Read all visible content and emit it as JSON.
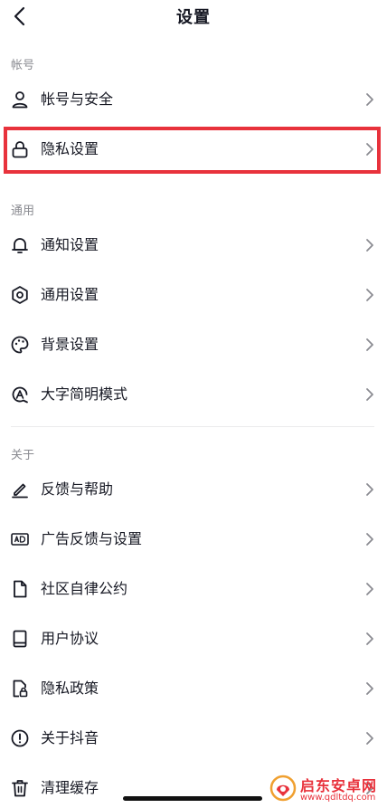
{
  "header": {
    "title": "设置"
  },
  "sections": {
    "account": "帐号",
    "general": "通用",
    "about": "关于"
  },
  "rows": [
    {
      "label": "帐号与安全"
    },
    {
      "label": "隐私设置"
    },
    {
      "label": "通知设置"
    },
    {
      "label": "通用设置"
    },
    {
      "label": "背景设置"
    },
    {
      "label": "大字简明模式"
    },
    {
      "label": "反馈与帮助"
    },
    {
      "label": "广告反馈与设置"
    },
    {
      "label": "社区自律公约"
    },
    {
      "label": "用户协议"
    },
    {
      "label": "隐私政策"
    },
    {
      "label": "关于抖音"
    },
    {
      "label": "清理缓存"
    }
  ],
  "icons": {
    "back": "chevron-left-icon",
    "row_chevron": "chevron-right-icon"
  },
  "colors": {
    "highlight": "#e8323c",
    "text": "#161823",
    "section_label": "#8a8b91",
    "chevron": "#8a8b91"
  },
  "watermark": {
    "title": "启东安卓网",
    "url": "www.qdltdq.com"
  }
}
